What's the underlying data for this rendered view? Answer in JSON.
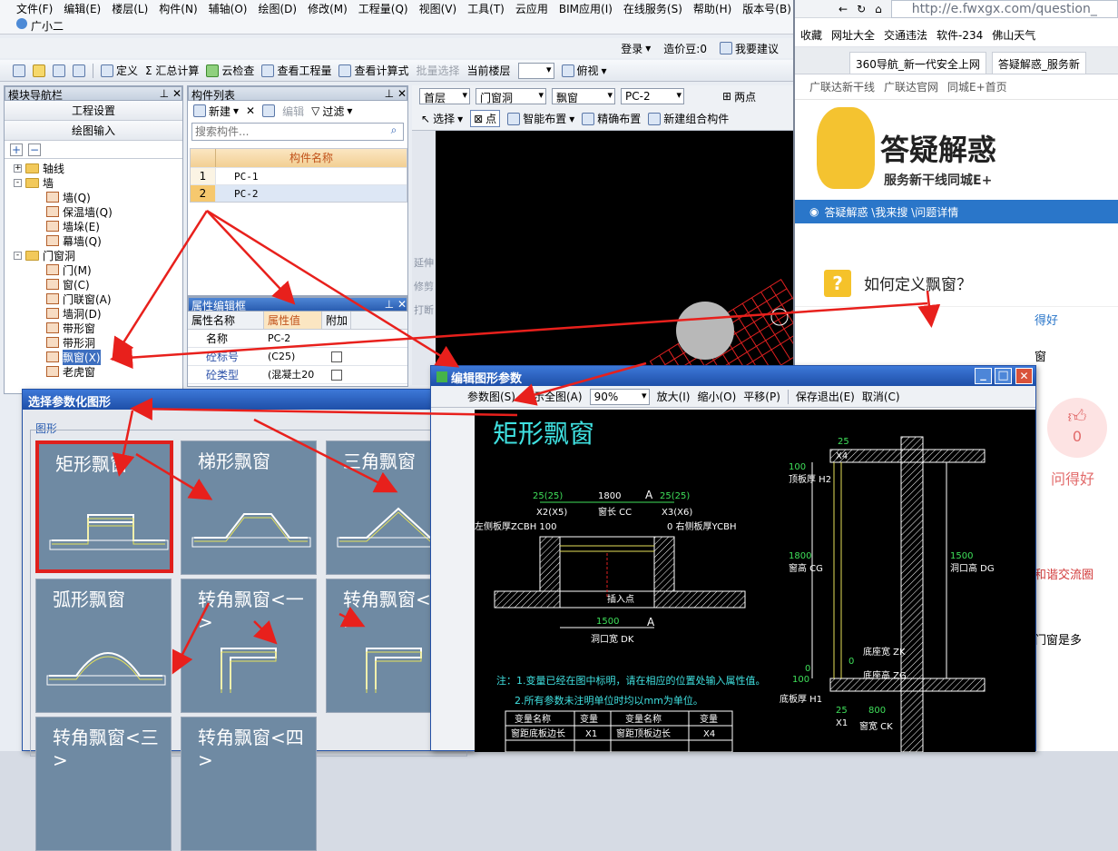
{
  "app": {
    "menu": [
      "文件(F)",
      "编辑(E)",
      "楼层(L)",
      "构件(N)",
      "辅轴(O)",
      "绘图(D)",
      "修改(M)",
      "工程量(Q)",
      "视图(V)",
      "工具(T)",
      "云应用",
      "BIM应用(I)",
      "在线服务(S)",
      "帮助(H)",
      "版本号(B)"
    ],
    "user": "广小二",
    "toolbar1": {
      "login": "登录",
      "price_bean": "造价豆:0",
      "suggest": "我要建议"
    },
    "toolbar2": {
      "define": "定义",
      "sum": "Σ 汇总计算",
      "cloud_check": "云检查",
      "view_qty": "查看工程量",
      "view_formula": "查看计算式",
      "batch_select": "批量选择",
      "current_floor_label": "当前楼层",
      "view_mode": "俯视"
    },
    "nav_panel": {
      "title": "模块导航栏",
      "btn_project": "工程设置",
      "btn_draw": "绘图输入",
      "tree": [
        {
          "label": "轴线",
          "level": 0,
          "type": "folder",
          "expand": "+"
        },
        {
          "label": "墙",
          "level": 0,
          "type": "folder",
          "expand": "-"
        },
        {
          "label": "墙(Q)",
          "level": 1,
          "type": "leaf"
        },
        {
          "label": "保温墙(Q)",
          "level": 1,
          "type": "leaf"
        },
        {
          "label": "墙垛(E)",
          "level": 1,
          "type": "leaf"
        },
        {
          "label": "幕墙(Q)",
          "level": 1,
          "type": "leaf"
        },
        {
          "label": "门窗洞",
          "level": 0,
          "type": "folder",
          "expand": "-"
        },
        {
          "label": "门(M)",
          "level": 1,
          "type": "leaf"
        },
        {
          "label": "窗(C)",
          "level": 1,
          "type": "leaf"
        },
        {
          "label": "门联窗(A)",
          "level": 1,
          "type": "leaf"
        },
        {
          "label": "墙洞(D)",
          "level": 1,
          "type": "leaf"
        },
        {
          "label": "带形窗",
          "level": 1,
          "type": "leaf"
        },
        {
          "label": "带形洞",
          "level": 1,
          "type": "leaf"
        },
        {
          "label": "飘窗(X)",
          "level": 1,
          "type": "leaf"
        },
        {
          "label": "老虎窗",
          "level": 1,
          "type": "leaf"
        }
      ]
    },
    "comp_panel": {
      "title": "构件列表",
      "new_label": "新建",
      "edit_label": "编辑",
      "filter_label": "过滤",
      "search_placeholder": "搜索构件...",
      "col_header": "构件名称",
      "rows": [
        {
          "no": "1",
          "name": "PC-1"
        },
        {
          "no": "2",
          "name": "PC-2"
        }
      ]
    },
    "prop_panel": {
      "title": "属性编辑框",
      "headers": [
        "属性名称",
        "属性值",
        "附加"
      ],
      "rows": [
        {
          "name": "名称",
          "value": "PC-2"
        },
        {
          "name": "砼标号",
          "value": "(C25)"
        },
        {
          "name": "砼类型",
          "value": "(混凝土20"
        }
      ]
    },
    "floor_bar": {
      "floor": "首层",
      "category": "门窗洞",
      "type": "飘窗",
      "component": "PC-2",
      "two_points": "两点"
    },
    "draw_bar": {
      "select": "选择",
      "point": "点",
      "smart_layout": "智能布置",
      "precise_layout": "精确布置",
      "new_group": "新建组合构件"
    },
    "side_tools": [
      "延伸",
      "修剪",
      "打断"
    ]
  },
  "shape_dialog": {
    "title": "选择参数化图形",
    "group_label": "图形",
    "tiles": [
      "矩形飘窗",
      "梯形飘窗",
      "三角飘窗",
      "弧形飘窗",
      "转角飘窗<一>",
      "转角飘窗<二>",
      "转角飘窗<三>",
      "转角飘窗<四>"
    ],
    "selected_index": 0
  },
  "edit_dialog": {
    "title": "编辑图形参数",
    "toolbar": {
      "param_view": "参数图(S)",
      "show_all": "显示全图(A)",
      "zoom": "90%",
      "zoom_in": "放大(I)",
      "zoom_out": "缩小(O)",
      "pan": "平移(P)",
      "save_exit": "保存退出(E)",
      "cancel": "取消(C)"
    },
    "drawing": {
      "heading": "矩形飘窗",
      "dim_top": [
        "25(25)",
        "1800",
        "A",
        "25(25)"
      ],
      "x_labels": [
        "X2(X5)",
        "窗长 CC",
        "X3(X6)"
      ],
      "left_thick": "左侧板厚ZCBH 100",
      "right_thick": "0  右侧板厚YCBH",
      "insert_point": "插入点",
      "bottom_dim": "1500",
      "bottom_label": "洞口宽 DK",
      "section_a": "A",
      "right_labels": {
        "top_25": "25",
        "x4": "X4",
        "top_thick_val": "100",
        "top_thick": "顶板厚 H2",
        "win_height_val": "1800",
        "win_height": "窗高 CG",
        "hole_val": "1500",
        "hole_height": "洞口高 DG",
        "bottom_width": "底座宽 ZK",
        "bottom_height": "底座高 ZG",
        "floor_thick_val": "100",
        "floor_thick": "底板厚 H1",
        "x1": "X1",
        "w800": "800",
        "win_width": "窗宽 CK",
        "v0": "0",
        "v0b": "0",
        "v25b": "25"
      },
      "note1": "注：1.变量已经在图中标明，请在相应的位置处输入属性值。",
      "note2": "2.所有参数未注明单位时均以mm为单位。",
      "table_headers": [
        "变量名称",
        "变量",
        "变量名称",
        "变量"
      ],
      "table_rows": [
        [
          "窗距底板边长",
          "X1",
          "窗距顶板边长",
          "X4"
        ]
      ]
    }
  },
  "browser": {
    "url": "http://e.fwxgx.com/question_",
    "favorites": [
      "收藏",
      "网址大全",
      "交通违法",
      "软件-234",
      "佛山天气"
    ],
    "tabs": [
      "360导航_新一代安全上网",
      "答疑解惑_服务新"
    ],
    "site_links": [
      "广联达新干线",
      "广联达官网",
      "同城E+首页"
    ],
    "banner_title": "答疑解惑",
    "banner_sub": "服务新干线同城E+",
    "breadcrumb": "答疑解惑 \\我来搜 \\问题详情",
    "question": "如何定义飘窗？",
    "answer_partial": "得好",
    "answer_partial2": "窗",
    "like_count": "0",
    "like_label": "问得好",
    "footer_text": "和谐交流圈",
    "footer_text2": "门窗是多"
  },
  "colors": {
    "arrow": "#e8201c",
    "accent": "#2a76c9",
    "tile": "#6f8aa3",
    "cad_cyan": "#3fe0e0"
  }
}
